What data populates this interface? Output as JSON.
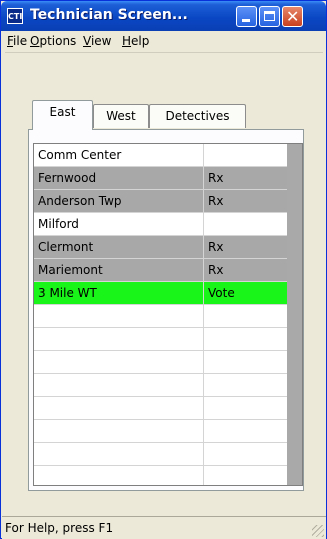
{
  "window": {
    "title": "Technician Screen...",
    "icon_text": "CTI",
    "controls": {
      "minimize": "minimize-icon",
      "maximize": "maximize-icon",
      "close": "✕"
    }
  },
  "menu": [
    {
      "label": "File",
      "key": "F",
      "rest": "ile"
    },
    {
      "label": "Options",
      "key": "O",
      "rest": "ptions"
    },
    {
      "label": "View",
      "key": "V",
      "rest": "iew"
    },
    {
      "label": "Help",
      "key": "H",
      "rest": "elp"
    }
  ],
  "tabs": [
    {
      "label": "East",
      "active": true
    },
    {
      "label": "West",
      "active": false
    },
    {
      "label": "Detectives",
      "active": false
    }
  ],
  "grid": {
    "rows": [
      {
        "name": "Comm Center",
        "status": "",
        "state": "normal"
      },
      {
        "name": "Fernwood",
        "status": "Rx",
        "state": "gray"
      },
      {
        "name": "Anderson Twp",
        "status": "Rx",
        "state": "gray"
      },
      {
        "name": "Milford",
        "status": "",
        "state": "normal"
      },
      {
        "name": "Clermont",
        "status": "Rx",
        "state": "gray"
      },
      {
        "name": "Mariemont",
        "status": "Rx",
        "state": "gray"
      },
      {
        "name": "3 Mile WT",
        "status": "Vote",
        "state": "green"
      },
      {
        "name": "",
        "status": "",
        "state": "normal"
      },
      {
        "name": "",
        "status": "",
        "state": "normal"
      },
      {
        "name": "",
        "status": "",
        "state": "normal"
      },
      {
        "name": "",
        "status": "",
        "state": "normal"
      },
      {
        "name": "",
        "status": "",
        "state": "normal"
      },
      {
        "name": "",
        "status": "",
        "state": "normal"
      },
      {
        "name": "",
        "status": "",
        "state": "normal"
      },
      {
        "name": "",
        "status": "",
        "state": "normal"
      }
    ],
    "colors": {
      "gray": "#a8a8a8",
      "green": "#19f519",
      "normal": "#ffffff"
    }
  },
  "status_bar": {
    "text": "For Help, press F1"
  }
}
